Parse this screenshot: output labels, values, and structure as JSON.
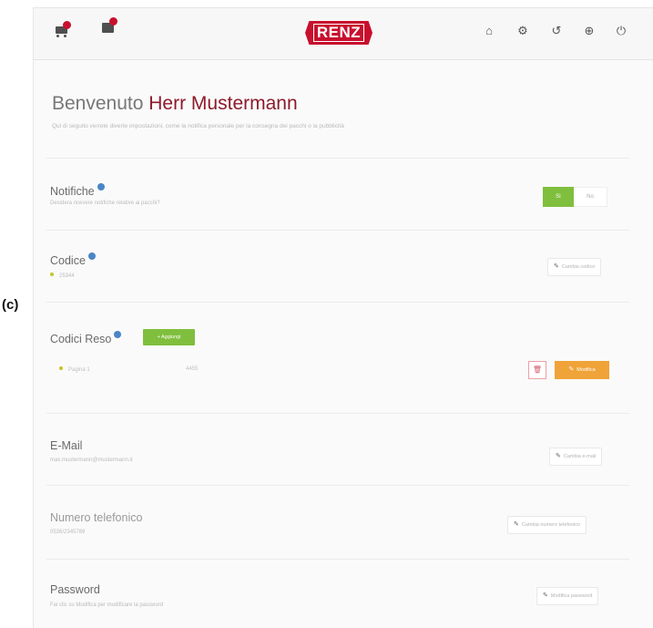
{
  "figure_label": "(c)",
  "topbar": {
    "logo_text": "RENZ",
    "left_icons": [
      "cart-with-badge-icon",
      "box-with-badge-icon"
    ],
    "right_icons": [
      "home-icon",
      "gear-icon",
      "history-icon",
      "globe-icon",
      "power-icon"
    ],
    "right_icon_glyphs": [
      "⌂",
      "⚙",
      "↺",
      "⊕",
      "⏻"
    ],
    "accent_color": "#c8102e"
  },
  "welcome": {
    "greeting": "Benvenuto",
    "name": "Herr Mustermann",
    "intro": "Qui di seguito verrete diverte impostazioni, come la notifica personale per la consegna dei pacchi o la pubblicità"
  },
  "notifications": {
    "title": "Notifiche",
    "subtitle": "Desidera ricevere notifiche relative ai pacchi?",
    "on_label": "Sì",
    "off_label": "No"
  },
  "code": {
    "title": "Codice",
    "value": "25344",
    "button": "Cambia codice"
  },
  "return_codes": {
    "title": "Codici Reso",
    "add_button": "+ Aggiungi",
    "item_name": "Pagina 1",
    "item_code": "4455",
    "edit_button": "Modifica",
    "delete_icon": "trash-icon"
  },
  "email": {
    "title": "E-Mail",
    "value": "max.mustermann@mustermann.it",
    "button": "Cambia e-mail"
  },
  "phone": {
    "title": "Numero telefonico",
    "value": "0536/2345789",
    "button": "Cambia numero telefonico"
  },
  "password": {
    "title": "Password",
    "subtitle": "Fai clic su Modifica per modificare la password",
    "button": "Modifica password"
  },
  "colors": {
    "green": "#7fbf3d",
    "orange": "#f0a338",
    "name_red": "#8c1a2b",
    "info_blue": "#4a86c5"
  }
}
